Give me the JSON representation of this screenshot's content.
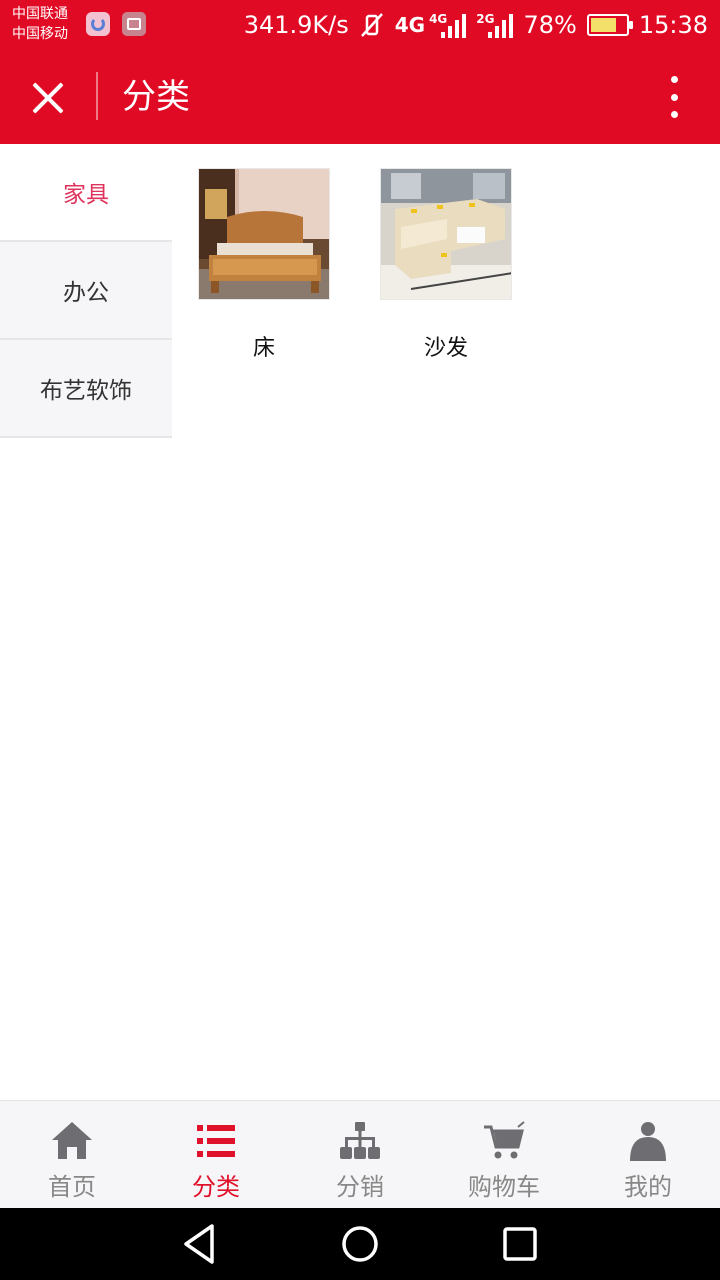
{
  "status_bar": {
    "carrier_1": "中国联通",
    "carrier_2": "中国移动",
    "net_speed": "341.9K/s",
    "network_1": "4G",
    "network_2": "4G",
    "network_3": "2G",
    "battery_level": "78%",
    "battery_fraction": 0.78,
    "time": "15:38"
  },
  "header": {
    "title": "分类",
    "close_icon": "close-icon",
    "more_icon": "more-vertical-icon"
  },
  "sidebar": {
    "items": [
      {
        "label": "家具",
        "active": true
      },
      {
        "label": "办公",
        "active": false
      },
      {
        "label": "布艺软饰",
        "active": false
      }
    ]
  },
  "products": [
    {
      "name": "床",
      "image": "bed-photo"
    },
    {
      "name": "沙发",
      "image": "sofa-photo"
    }
  ],
  "tabbar": {
    "tabs": [
      {
        "label": "首页",
        "icon": "home-icon",
        "active": false
      },
      {
        "label": "分类",
        "icon": "list-icon",
        "active": true
      },
      {
        "label": "分销",
        "icon": "org-chart-icon",
        "active": false
      },
      {
        "label": "购物车",
        "icon": "cart-icon",
        "active": false
      },
      {
        "label": "我的",
        "icon": "user-icon",
        "active": false
      }
    ]
  },
  "colors": {
    "brand_red": "#e10a24",
    "active_text": "#e0335c",
    "tab_active": "#e0112b",
    "tab_inactive": "#888888"
  }
}
